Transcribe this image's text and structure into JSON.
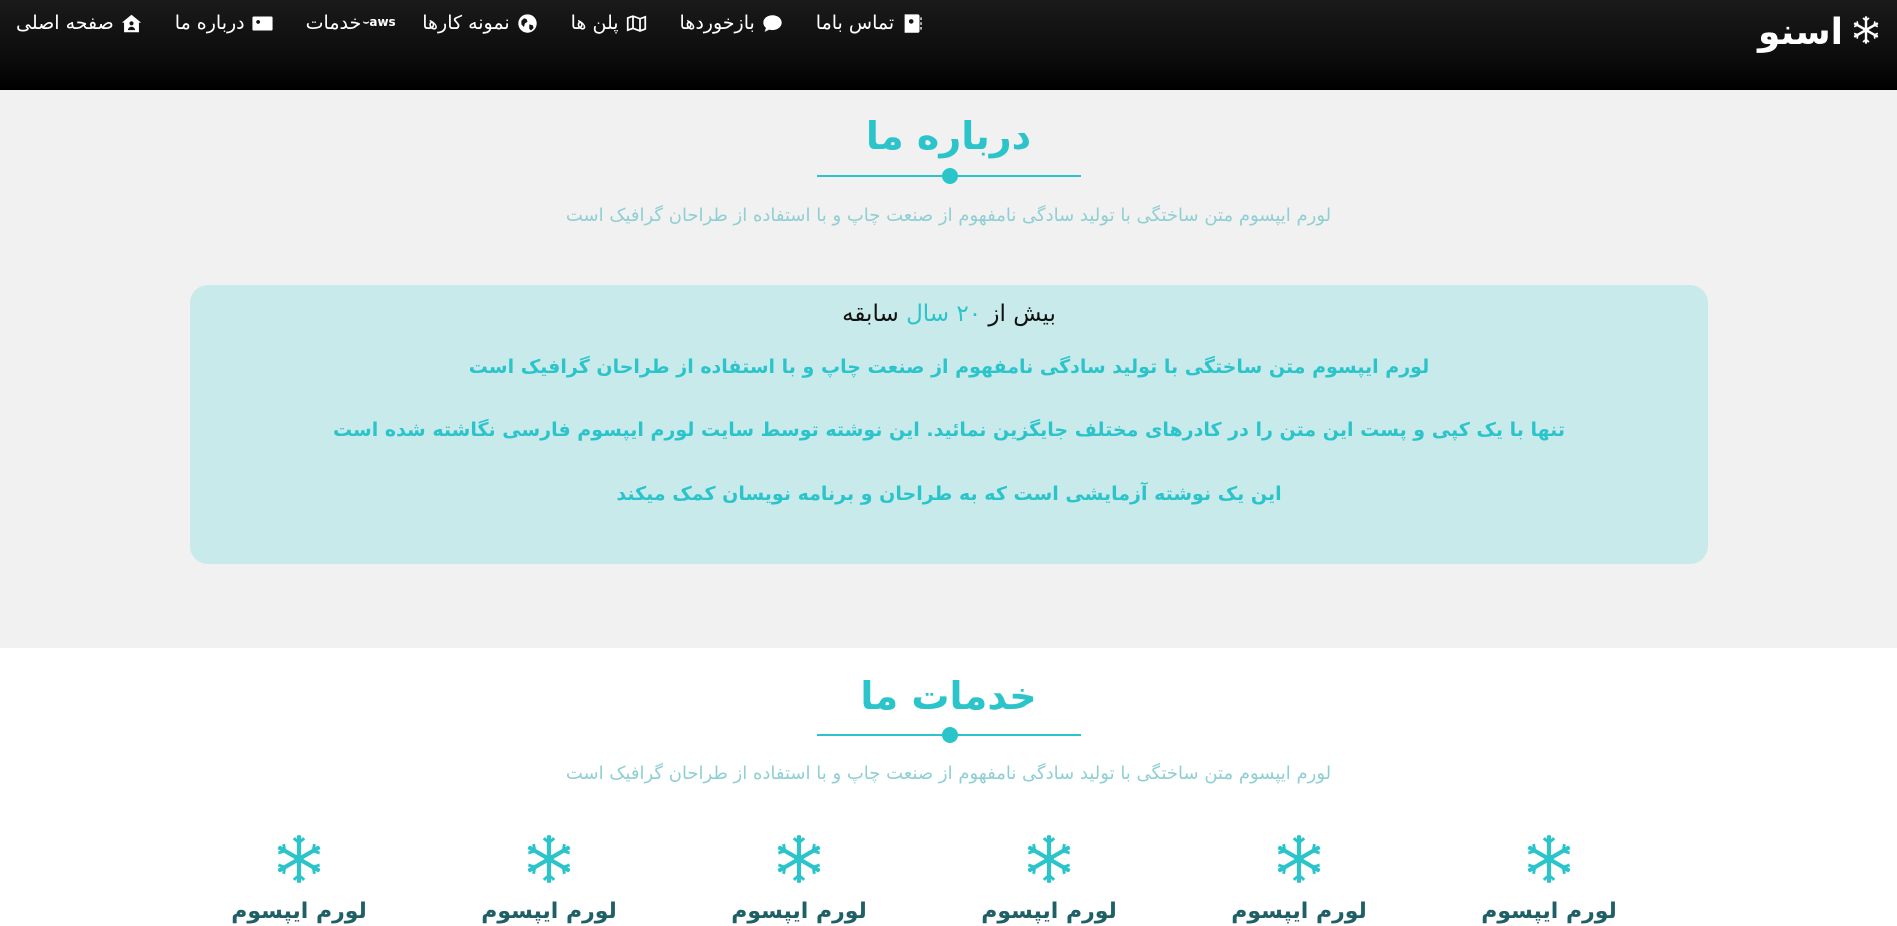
{
  "brand": {
    "name": "اسنو",
    "icon": "snowflake-icon"
  },
  "nav": {
    "items": [
      {
        "label": "صفحه اصلی",
        "icon": "house-user-icon"
      },
      {
        "label": "درباره ما",
        "icon": "id-card-icon"
      },
      {
        "label": "خدمات",
        "icon": "aws-icon"
      },
      {
        "label": "نمونه کارها",
        "icon": "globe-icon"
      },
      {
        "label": "پلن ها",
        "icon": "map-icon"
      },
      {
        "label": "بازخوردها",
        "icon": "comment-icon"
      },
      {
        "label": "تماس باما",
        "icon": "address-book-icon"
      }
    ]
  },
  "about": {
    "title": "درباره ما",
    "subtitle": "لورم ایپسوم متن ساختگی با تولید سادگی نامفهوم از صنعت چاپ و با استفاده از طراحان گرافیک است",
    "card": {
      "heading_prefix": "بیش از ",
      "heading_accent": "۲۰ سال",
      "heading_suffix": " سابقه",
      "lines": [
        "لورم ایپسوم متن ساختگی با تولید سادگی نامفهوم از صنعت چاپ و با استفاده از طراحان گرافیک است",
        "تنها با یک کپی و پست این متن را در کادرهای مختلف جایگزین نمائید. این نوشته توسط سایت لورم ایپسوم فارسی نگاشته شده است",
        "این یک نوشته آزمایشی است که به طراحان و برنامه نویسان کمک میکند"
      ]
    }
  },
  "services": {
    "title": "خدمات ما",
    "subtitle": "لورم ایپسوم متن ساختگی با تولید سادگی نامفهوم از صنعت چاپ و با استفاده از طراحان گرافیک است",
    "items": [
      {
        "title": "لورم ایپسوم",
        "icon": "snowflake-icon"
      },
      {
        "title": "لورم ایپسوم",
        "icon": "snowflake-icon"
      },
      {
        "title": "لورم ایپسوم",
        "icon": "snowflake-icon"
      },
      {
        "title": "لورم ایپسوم",
        "icon": "snowflake-icon"
      },
      {
        "title": "لورم ایپسوم",
        "icon": "snowflake-icon"
      },
      {
        "title": "لورم ایپسوم",
        "icon": "snowflake-icon"
      }
    ]
  },
  "colors": {
    "accent": "#2cc4cb",
    "card_bg": "#c8eaea",
    "section_bg": "#f1f1f1",
    "nav_bg": "#0d0d0d"
  }
}
